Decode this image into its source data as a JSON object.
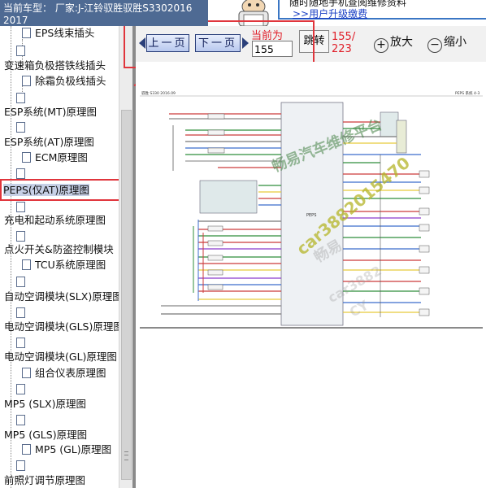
{
  "vehicle_header": {
    "line1": "当前车型： 厂家:J-江铃驭胜驭胜S3302016",
    "line2": "2017"
  },
  "banner": {
    "notice": "随时随地手机查阅维修资料",
    "upgrade_prefix": ">>",
    "upgrade_link": "用户升级缴费"
  },
  "toolbar": {
    "prev_label": "上一页",
    "next_label": "下一页",
    "current_label": "当前为",
    "current_page": "155",
    "goto_label": "跳转",
    "page_total_line1": "155/",
    "page_total_line2": "223",
    "zoom_in_label": "放大",
    "zoom_out_label": "缩小",
    "zoom_in_glyph": "+",
    "zoom_out_glyph": "−"
  },
  "sidebar": {
    "items": [
      {
        "label": "EPS线束插头"
      },
      {
        "label": "变速箱负极搭铁线插头"
      },
      {
        "label": "除霜负极线插头"
      },
      {
        "label": "ESP系统(MT)原理图"
      },
      {
        "label": "ESP系统(AT)原理图"
      },
      {
        "label": "ECM原理图"
      },
      {
        "label": "PEPS(仅AT)原理图"
      },
      {
        "label": "充电和起动系统原理图"
      },
      {
        "label": "点火开关&防盗控制模块"
      },
      {
        "label": "TCU系统原理图"
      },
      {
        "label": "自动空调模块(SLX)原理图"
      },
      {
        "label": "电动空调模块(GLS)原理图"
      },
      {
        "label": "电动空调模块(GL)原理图"
      },
      {
        "label": "组合仪表原理图"
      },
      {
        "label": "MP5 (SLX)原理图"
      },
      {
        "label": "MP5 (GLS)原理图"
      },
      {
        "label": "MP5 (GL)原理图"
      },
      {
        "label": "前照灯调节原理图"
      }
    ]
  },
  "diagram": {
    "header_left": "驭胜 S330 2016.09",
    "header_right": "PEPS 系统 4-3",
    "module_label": "PEPS",
    "watermark_1": "畅易汽车维修平台",
    "watermark_2": "car3882015470",
    "watermark_3": "畅易",
    "watermark_4": "car3882",
    "watermark_5": "CY"
  },
  "colors": {
    "header_bg": "#4e6a93",
    "highlight_red": "#e0353c",
    "selected_bg": "#c6d0e6",
    "button_text": "#0c1a55",
    "accent_red_text": "#e0202a"
  }
}
